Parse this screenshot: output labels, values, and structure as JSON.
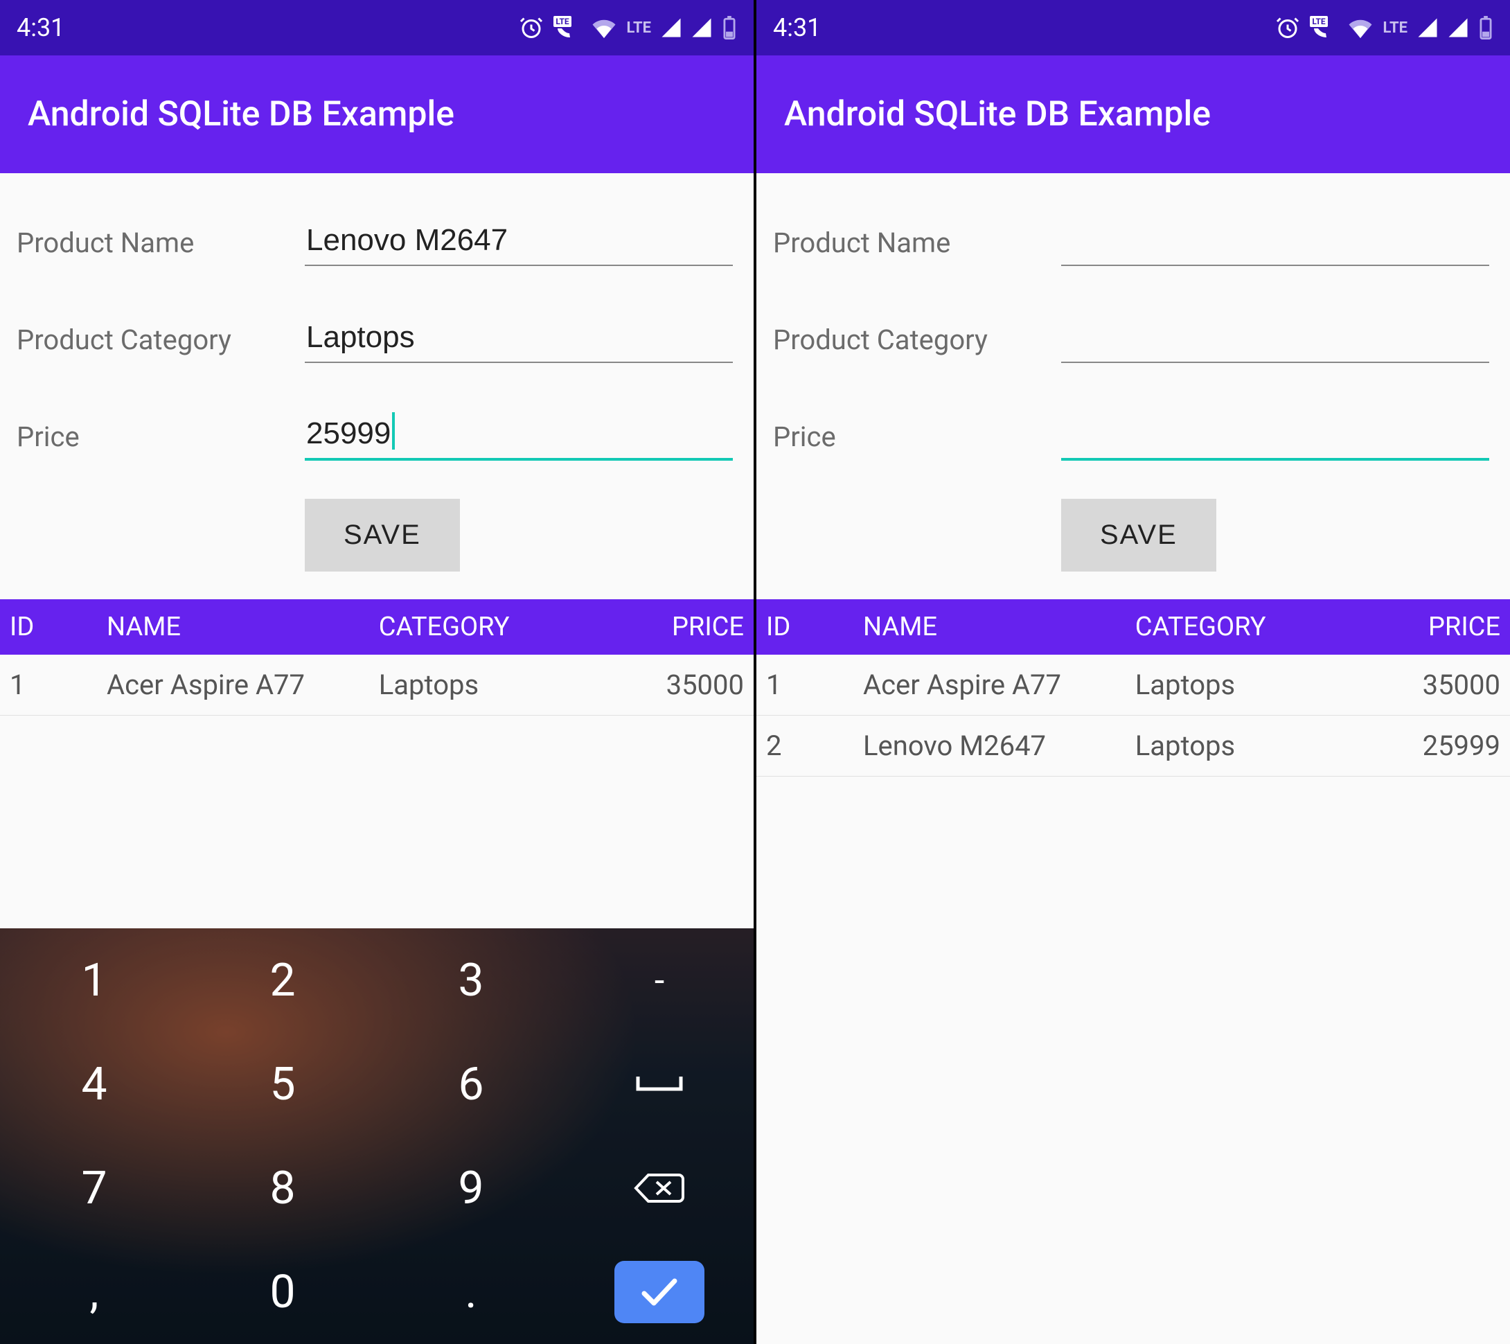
{
  "status": {
    "time": "4:31",
    "lte_label": "LTE"
  },
  "appbar": {
    "title": "Android SQLite DB Example"
  },
  "form": {
    "labels": {
      "name": "Product Name",
      "category": "Product Category",
      "price": "Price"
    },
    "save_label": "SAVE"
  },
  "table": {
    "headers": {
      "id": "ID",
      "name": "NAME",
      "category": "CATEGORY",
      "price": "PRICE"
    }
  },
  "left": {
    "inputs": {
      "name": "Lenovo M2647",
      "category": "Laptops",
      "price": "25999"
    },
    "rows": [
      {
        "id": "1",
        "name": "Acer Aspire A77",
        "category": "Laptops",
        "price": "35000"
      }
    ]
  },
  "right": {
    "inputs": {
      "name": "",
      "category": "",
      "price": ""
    },
    "rows": [
      {
        "id": "1",
        "name": "Acer Aspire A77",
        "category": "Laptops",
        "price": "35000"
      },
      {
        "id": "2",
        "name": "Lenovo M2647",
        "category": "Laptops",
        "price": "25999"
      }
    ]
  },
  "keypad": {
    "keys": [
      [
        "1",
        "2",
        "3",
        "-"
      ],
      [
        "4",
        "5",
        "6",
        "space"
      ],
      [
        "7",
        "8",
        "9",
        "backspace"
      ],
      [
        ",",
        "0",
        ".",
        "enter"
      ]
    ]
  }
}
